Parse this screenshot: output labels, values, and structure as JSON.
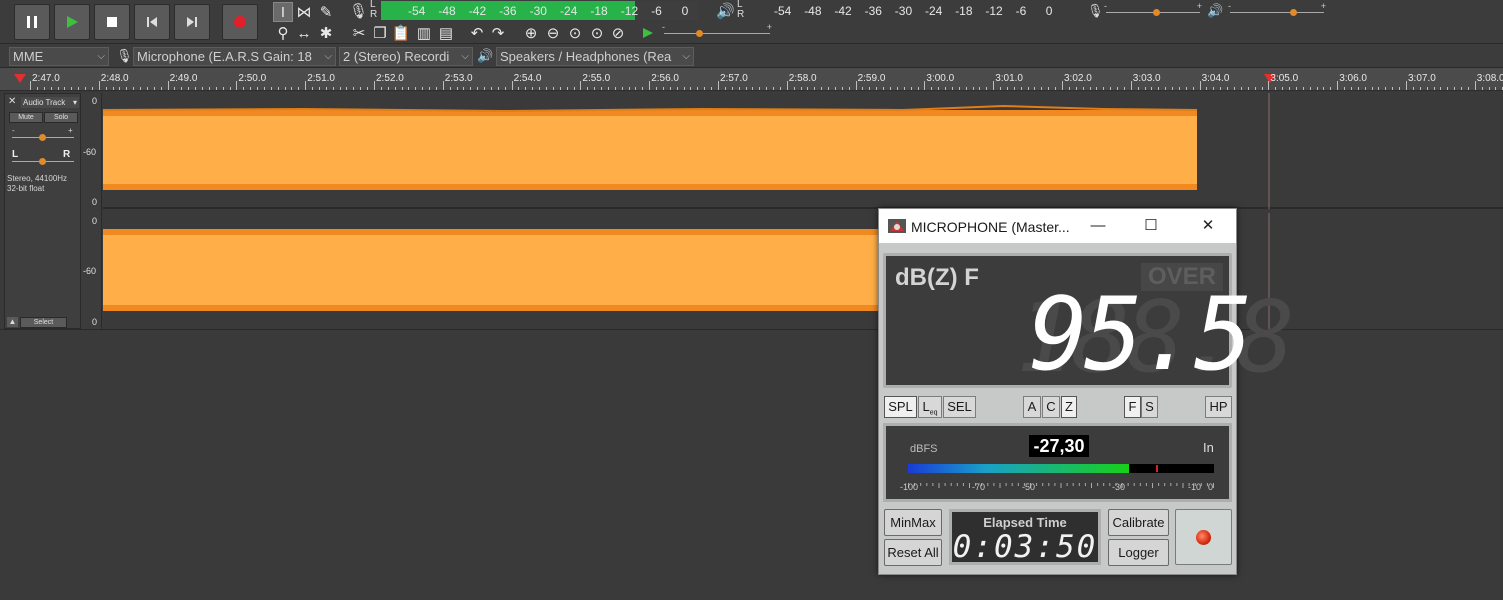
{
  "toolbar": {
    "pause_label": "Pause",
    "play_label": "Play",
    "stop_label": "Stop",
    "skip_start_label": "Skip to Start",
    "skip_end_label": "Skip to End",
    "record_label": "Record",
    "record_meter": {
      "lr": [
        "L",
        "R"
      ],
      "scale": [
        "-54",
        "-48",
        "-42",
        "-36",
        "-30",
        "-24",
        "-18",
        "-12",
        "-6",
        "0"
      ],
      "level_fraction": 0.8
    },
    "playback_meter": {
      "lr": [
        "L",
        "R"
      ],
      "scale": [
        "-54",
        "-48",
        "-42",
        "-36",
        "-30",
        "-24",
        "-18",
        "-12",
        "-6",
        "0"
      ]
    },
    "slider_minus": "-",
    "slider_plus": "+"
  },
  "devices": {
    "host": "MME",
    "recording_device": "Microphone (E.A.R.S Gain: 18",
    "channels": "2 (Stereo) Recordi",
    "playback_device": "Speakers / Headphones (Rea"
  },
  "ruler": {
    "labels": [
      "2:47.0",
      "2:48.0",
      "2:49.0",
      "2:50.0",
      "2:51.0",
      "2:52.0",
      "2:53.0",
      "2:54.0",
      "2:55.0",
      "2:56.0",
      "2:57.0",
      "2:58.0",
      "2:59.0",
      "3:00.0",
      "3:01.0",
      "3:02.0",
      "3:03.0",
      "3:04.0",
      "3:05.0",
      "3:06.0",
      "3:07.0",
      "3:08.0"
    ]
  },
  "track": {
    "name": "Audio Track",
    "mute": "Mute",
    "solo": "Solo",
    "gain_minus": "-",
    "gain_plus": "+",
    "pan_l": "L",
    "pan_r": "R",
    "info_line1": "Stereo, 44100Hz",
    "info_line2": "32-bit float",
    "select": "Select",
    "scale_top": "0",
    "scale_mid": "-60",
    "scale_bottom": "0",
    "waveform_color": "#ffa93f"
  },
  "meter_window": {
    "title": "MICROPHONE (Master...",
    "weighting_label": "dB(Z) F",
    "over_label": "OVER",
    "reading": "95.5",
    "buttons": {
      "spl": "SPL",
      "leq": "L",
      "leq_sub": "eq",
      "sel": "SEL",
      "a": "A",
      "c": "C",
      "z": "Z",
      "f": "F",
      "s": "S",
      "hp": "HP"
    },
    "dbfs_label": "dBFS",
    "dbfs_value": "-27,30",
    "in_label": "In",
    "dbfs_scale": [
      "-100",
      "-70",
      "-50",
      "-30",
      "-10",
      "0"
    ],
    "minmax": "MinMax",
    "reset_all": "Reset All",
    "elapsed_label": "Elapsed Time",
    "elapsed_value": "0:03:50",
    "calibrate": "Calibrate",
    "logger": "Logger"
  }
}
